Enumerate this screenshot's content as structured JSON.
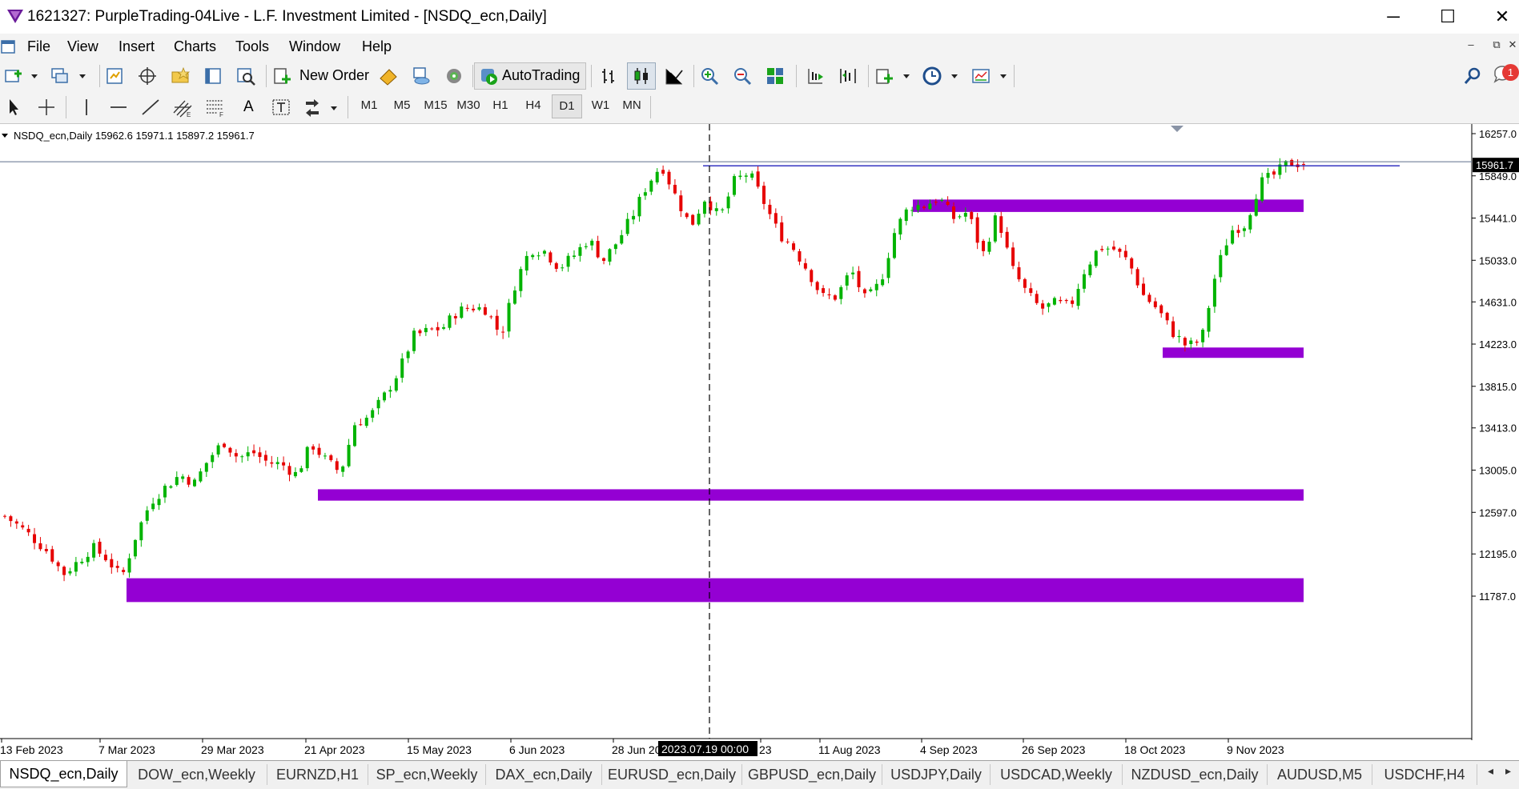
{
  "window": {
    "title": "1621327: PurpleTrading-04Live - L.F. Investment Limited - [NSDQ_ecn,Daily]",
    "minimize": "─",
    "maximize": "☐",
    "close": "✕"
  },
  "menu": {
    "items": [
      "File",
      "View",
      "Insert",
      "Charts",
      "Tools",
      "Window",
      "Help"
    ],
    "mdi": {
      "min": "–",
      "restore": "⧉",
      "close": "✕"
    }
  },
  "toolbar": {
    "new_order": "New Order",
    "autotrading": "AutoTrading",
    "timeframes": [
      "M1",
      "M5",
      "M15",
      "M30",
      "H1",
      "H4",
      "D1",
      "W1",
      "MN"
    ],
    "active_timeframe": "D1",
    "notification_count": "1",
    "text_tool": "A"
  },
  "chart": {
    "info": "NSDQ_ecn,Daily  15962.6 15971.1 15897.2 15961.7",
    "current_price_label": "15961.7",
    "crosshair_time_label": "2023.07.19 00:00",
    "colors": {
      "bull": "#00b300",
      "bear": "#e60000",
      "zone": "#9400d3",
      "price_line": "#2222bb",
      "grid_line": "#5d6d8a",
      "axis": "#000000"
    }
  },
  "chart_data": {
    "type": "candlestick",
    "symbol": "NSDQ_ecn",
    "timeframe": "Daily",
    "ohlc_last": {
      "open": 15962.6,
      "high": 15971.1,
      "low": 15897.2,
      "close": 15961.7
    },
    "y_ticks": [
      16257.0,
      15849.0,
      15441.0,
      15033.0,
      14631.0,
      14223.0,
      13815.0,
      13413.0,
      13005.0,
      12597.0,
      12195.0,
      11787.0
    ],
    "y_tick_labels": [
      "16257.0",
      "15849.0",
      "15441.0",
      "15033.0",
      "14631.0",
      "14223.0",
      "13815.0",
      "13413.0",
      "13005.0",
      "12597.0",
      "12195.0",
      "11787.0"
    ],
    "x_ticks": [
      "13 Feb 2023",
      "7 Mar 2023",
      "29 Mar 2023",
      "21 Apr 2023",
      "15 May 2023",
      "6 Jun 2023",
      "28 Jun 2023",
      "23",
      "11 Aug 2023",
      "4 Sep 2023",
      "26 Sep 2023",
      "18 Oct 2023",
      "9 Nov 2023"
    ],
    "ylim": [
      11680,
      16330
    ],
    "close_path": [
      12560,
      12460,
      12340,
      12210,
      12000,
      12120,
      12260,
      12150,
      11960,
      12380,
      12700,
      12840,
      12960,
      12880,
      13120,
      13280,
      13120,
      13180,
      13080,
      13060,
      12960,
      13260,
      13100,
      12980,
      13460,
      13520,
      13720,
      13960,
      14300,
      14350,
      14380,
      14540,
      14580,
      14560,
      14300,
      14820,
      15140,
      15120,
      14960,
      15080,
      15240,
      15030,
      15220,
      15460,
      15760,
      15960,
      15640,
      15360,
      15640,
      15440,
      15800,
      15880,
      15600,
      15300,
      15160,
      14940,
      14680,
      14680,
      14940,
      14640,
      14820,
      15320,
      15560,
      15560,
      15640,
      15440,
      15500,
      15080,
      15480,
      14960,
      14720,
      14560,
      14620,
      14580,
      14940,
      15160,
      15140,
      15020,
      14700,
      14560,
      14340,
      14200,
      14260,
      14920,
      15320,
      15380,
      15780,
      15860,
      15980,
      15961.7
    ],
    "zones": [
      {
        "top": 15620,
        "bottom": 15500
      },
      {
        "top": 14190,
        "bottom": 14090
      },
      {
        "top": 12820,
        "bottom": 12710
      },
      {
        "top": 11960,
        "bottom": 11730
      }
    ],
    "current_price": 15961.7,
    "grid": false,
    "legend": "none"
  },
  "tabs": {
    "items": [
      "NSDQ_ecn,Daily",
      "DOW_ecn,Weekly",
      "EURNZD,H1",
      "SP_ecn,Weekly",
      "DAX_ecn,Daily",
      "EURUSD_ecn,Daily",
      "GBPUSD_ecn,Daily",
      "USDJPY,Daily",
      "USDCAD,Weekly",
      "NZDUSD_ecn,Daily",
      "AUDUSD,M5",
      "USDCHF,H4"
    ],
    "scroll_left": "◂",
    "scroll_right": "▸"
  }
}
